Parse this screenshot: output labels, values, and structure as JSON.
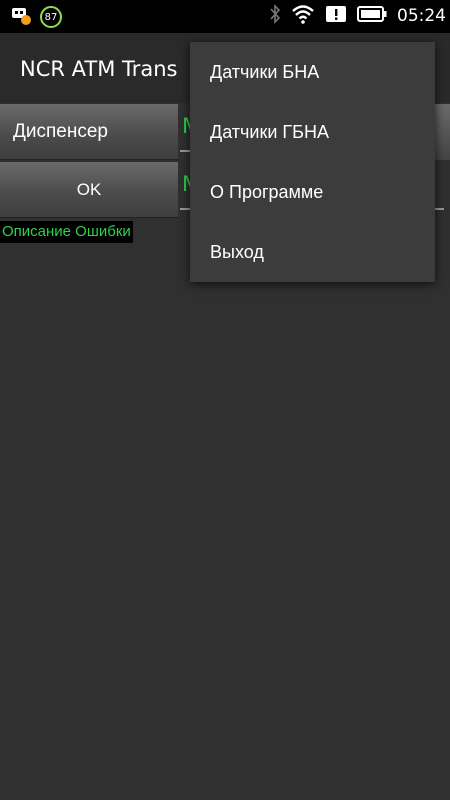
{
  "status_bar": {
    "notification_badge": "87",
    "time": "05:24",
    "icons": [
      "notification-app-icon",
      "bluetooth-icon",
      "wifi-icon",
      "alert-icon",
      "battery-icon"
    ]
  },
  "app_bar": {
    "title": "NCR ATM Trans"
  },
  "main": {
    "dispenser_button_label": "Диспенсер",
    "ok_button_label": "OK",
    "field1_value": "M",
    "field2_value": "M",
    "error_description": "Описание Ошибки"
  },
  "menu": {
    "items": [
      {
        "label": "Датчики БНА"
      },
      {
        "label": "Датчики ГБНА"
      },
      {
        "label": "О Программе"
      },
      {
        "label": "Выход"
      }
    ]
  },
  "colors": {
    "accent_green": "#2ed04f",
    "background": "#303030",
    "menu_background": "#3c3c3c"
  }
}
